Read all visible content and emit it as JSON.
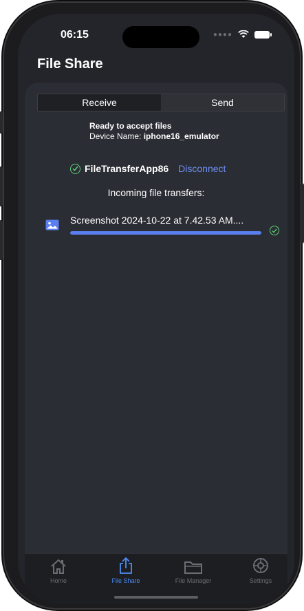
{
  "status_bar": {
    "time": "06:15"
  },
  "header": {
    "title": "File Share"
  },
  "segmented": {
    "receive_label": "Receive",
    "send_label": "Send",
    "selected": "Receive"
  },
  "receive_status": {
    "ready_text": "Ready to accept files",
    "device_name_label": "Device Name: ",
    "device_name_value": "iphone16_emulator"
  },
  "connection": {
    "peer_name": "FileTransferApp86",
    "disconnect_label": "Disconnect"
  },
  "incoming": {
    "label": "Incoming file transfers:",
    "files": [
      {
        "name": "Screenshot 2024-10-22 at 7.42.53 AM....",
        "progress": 1.0,
        "status": "complete"
      }
    ]
  },
  "tabs": [
    {
      "label": "Home",
      "icon": "home-icon",
      "active": false
    },
    {
      "label": "File Share",
      "icon": "share-icon",
      "active": true
    },
    {
      "label": "File Manager",
      "icon": "folder-icon",
      "active": false
    },
    {
      "label": "Settings",
      "icon": "gear-icon",
      "active": false
    }
  ],
  "colors": {
    "accent": "#4b8df6",
    "success": "#5fd07a",
    "progress": "#5b7ff0",
    "link": "#6e8ff2"
  }
}
